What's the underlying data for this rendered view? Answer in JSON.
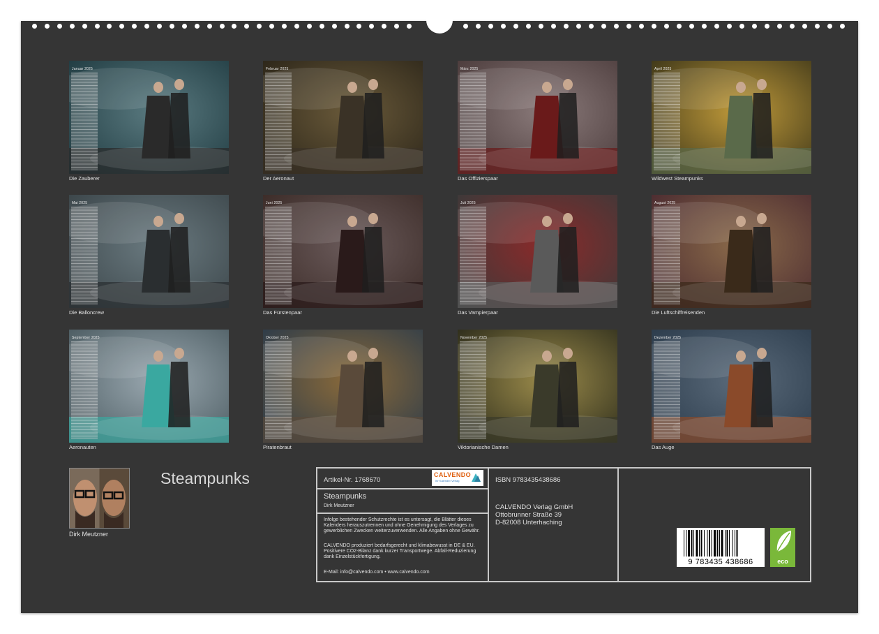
{
  "months": [
    {
      "label": "Januar 2025",
      "caption": "Die Zauberer",
      "colors": [
        "#1f3a40",
        "#5a7a80",
        "#2a2a2a"
      ]
    },
    {
      "label": "Februar 2025",
      "caption": "Der Aeronaut",
      "colors": [
        "#2a2418",
        "#6a5a3a",
        "#3a3226"
      ]
    },
    {
      "label": "März 2025",
      "caption": "Das Offizierspaar",
      "colors": [
        "#4a3a3a",
        "#8a7a7a",
        "#6a1a1a"
      ]
    },
    {
      "label": "April 2025",
      "caption": "Wildwest Steampunks",
      "colors": [
        "#3a3418",
        "#c09a3a",
        "#5a6a4a"
      ]
    },
    {
      "label": "Mai 2025",
      "caption": "Die Balloncrew",
      "colors": [
        "#3a4448",
        "#6a7a80",
        "#2a2e30"
      ]
    },
    {
      "label": "Juni 2025",
      "caption": "Das Fürstenpaar",
      "colors": [
        "#3a2a26",
        "#6a5a5a",
        "#2a1a1a"
      ]
    },
    {
      "label": "Juli 2025",
      "caption": "Das Vampierpaar",
      "colors": [
        "#3a3a3a",
        "#8a2a2a",
        "#5a5a5a"
      ]
    },
    {
      "label": "August 2025",
      "caption": "Die Luftschiffreisenden",
      "colors": [
        "#4a2a30",
        "#8a6a4a",
        "#3a2a1a"
      ]
    },
    {
      "label": "September 2025",
      "caption": "Aeronauten",
      "colors": [
        "#4a5a60",
        "#9aa8b0",
        "#3aa8a0"
      ]
    },
    {
      "label": "Oktober 2025",
      "caption": "Piratenbraut",
      "colors": [
        "#2a3a4a",
        "#8a6a3a",
        "#5a4a3a"
      ]
    },
    {
      "label": "November 2025",
      "caption": "Viktorianische Damen",
      "colors": [
        "#2a2a1a",
        "#9a8a4a",
        "#3a3a2a"
      ]
    },
    {
      "label": "Dezember 2025",
      "caption": "Das Auge",
      "colors": [
        "#2a3a4a",
        "#5a6a7a",
        "#8a4a2a"
      ]
    }
  ],
  "title": "Steampunks",
  "author": "Dirk Meutzner",
  "info": {
    "article": "Artikel-Nr. 1768670",
    "logo_name": "CALVENDO",
    "logo_sub": "Ihr Kalender-Verlag",
    "product_title": "Steampunks",
    "product_author": "Dirk Meutzner",
    "legal1": "Infolge bestehender Schutzrechte ist es untersagt, die Blätter dieses Kalenders herauszutrennen und ohne Genehmigung des Verlages zu gewerblichen Zwecken weiterzuverwenden. Alle Angaben ohne Gewähr.",
    "legal2": "CALVENDO produziert bedarfsgerecht und klimabewusst in DE & EU. Positivere CO2-Bilanz dank kurzer Transportwege. Abfall-Reduzierung dank Einzelstückfertigung.",
    "contact": "E-Mail: info@calvendo.com • www.calvendo.com",
    "isbn": "ISBN 9783435438686",
    "publisher": "CALVENDO Verlag GmbH",
    "street": "Ottobrunner Straße 39",
    "city": "D-82008 Unterhaching",
    "barcode_digits": "9 783435 438686",
    "eco_label": "eco"
  }
}
